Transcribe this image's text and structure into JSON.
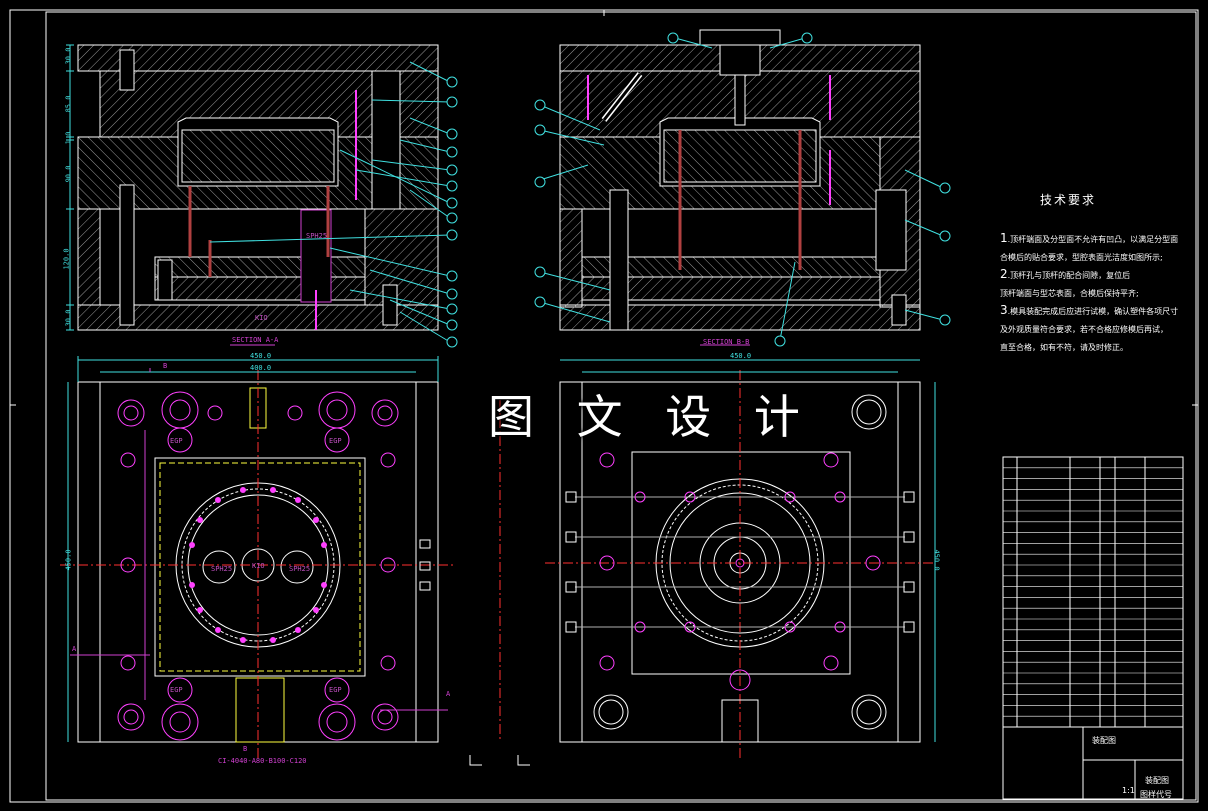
{
  "watermark": "图 文 设 计",
  "technical_requirements": {
    "heading": "技术要求",
    "items": [
      {
        "num": "1",
        "text": ".顶杆端面及分型面不允许有凹凸，以满足分型面"
      },
      {
        "num": "",
        "text": "合模后的贴合要求，型腔表面光洁度如图所示;"
      },
      {
        "num": "2",
        "text": ".顶杆孔与顶杆的配合间隙，复位后"
      },
      {
        "num": "",
        "text": "顶杆端面与型芯表面，合模后保持平齐;"
      },
      {
        "num": "3",
        "text": ".模具装配完成后应进行试模，确认塑件各项尺寸"
      },
      {
        "num": "",
        "text": "及外观质量符合要求，若不合格应修模后再试，"
      },
      {
        "num": "",
        "text": "直至合格，如有不符，请及时修正。"
      }
    ]
  },
  "section_labels": {
    "aa": "SECTION A-A",
    "bb": "SECTION B-B"
  },
  "dimensions": {
    "top_view_overall": "450.0",
    "top_view_inner": "400.0",
    "top_view_height": "450.0",
    "bottom_view_overall": "450.0",
    "bottom_view_height": "450.0",
    "stack": [
      "30.0",
      "85.0",
      "1.0",
      "90.0",
      "120.0",
      "30.0"
    ]
  },
  "spec_texts": {
    "mold_base": "CI-4040-A80-B100-C120",
    "core_label": "KIO",
    "spring_label": "SPH25",
    "ejector_label": "EGP"
  },
  "section_markers": {
    "a": "A",
    "b": "B"
  },
  "title_block": {
    "title_left": "装配图",
    "title_right": "装配图",
    "drawing_no": "图样代号",
    "scale": "1:1"
  },
  "colors": {
    "background": "#000000",
    "outline": "#ffffff",
    "hatch": "#b0b0b0",
    "dimension": "#40e0e0",
    "centerline": "#ff3030",
    "hidden": "#ffff40",
    "bolt": "#ff40ff",
    "rod": "#b04040",
    "balloon": "#40e0e0"
  }
}
